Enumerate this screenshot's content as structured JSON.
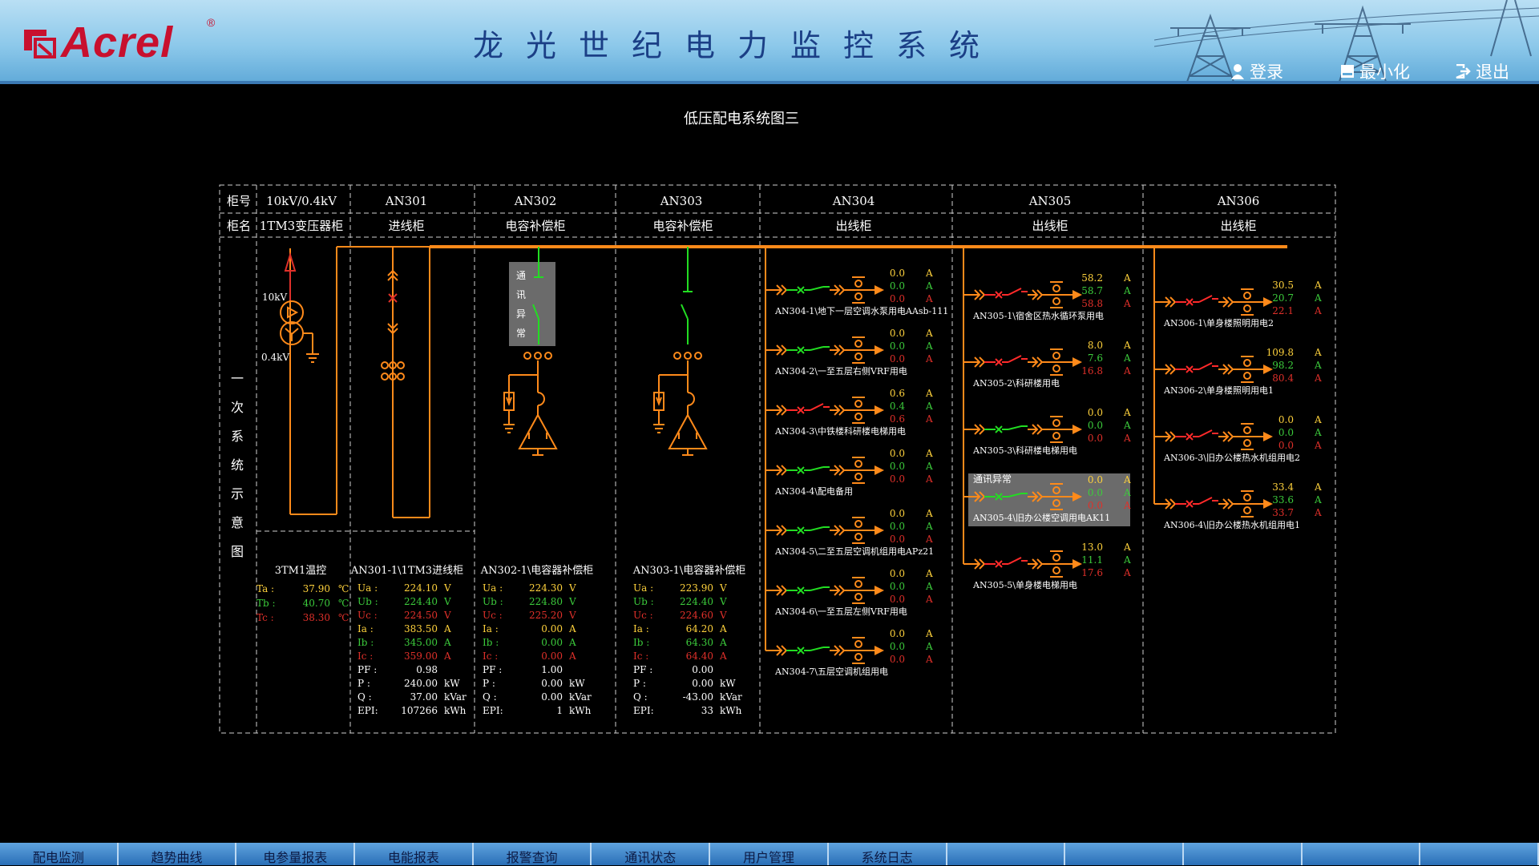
{
  "header": {
    "logo_text": "Acrel",
    "logo_reg": "®",
    "title": "龙光世纪电力监控系统",
    "buttons": [
      {
        "name": "login",
        "label": "登录",
        "icon": "user-icon"
      },
      {
        "name": "minimize",
        "label": "最小化",
        "icon": "minimize-icon"
      },
      {
        "name": "logout",
        "label": "退出",
        "icon": "logout-icon"
      }
    ]
  },
  "page_title": "低压配电系统图三",
  "grid": {
    "row_label_number": "柜号",
    "row_label_name": "柜名",
    "side_label": "一次系统示意图",
    "cabinets": [
      {
        "number": "10kV/0.4kV",
        "name": "1TM3变压器柜"
      },
      {
        "number": "AN301",
        "name": "进线柜"
      },
      {
        "number": "AN302",
        "name": "电容补偿柜"
      },
      {
        "number": "AN303",
        "name": "电容补偿柜"
      },
      {
        "number": "AN304",
        "name": "出线柜"
      },
      {
        "number": "AN305",
        "name": "出线柜"
      },
      {
        "number": "AN306",
        "name": "出线柜"
      }
    ]
  },
  "transformer": {
    "hv_label": "10kV",
    "lv_label": "0.4kV"
  },
  "comm_error_label": "通讯异常",
  "comm_error_vertical": [
    "通",
    "讯",
    "异",
    "常"
  ],
  "temp_panel": {
    "title": "3TM1温控",
    "rows": [
      {
        "label": "Ta :",
        "value": "37.90",
        "unit": "℃",
        "color": "#ffd23c"
      },
      {
        "label": "Tb :",
        "value": "40.70",
        "unit": "℃",
        "color": "#3ccc3c"
      },
      {
        "label": "Tc :",
        "value": "38.30",
        "unit": "℃",
        "color": "#e0302a"
      }
    ]
  },
  "meter_panels": [
    {
      "title": "AN301-1\\1TM3进线柜",
      "rows": [
        {
          "label": "Ua :",
          "value": "224.10",
          "unit": "V",
          "color": "#ffd23c"
        },
        {
          "label": "Ub :",
          "value": "224.40",
          "unit": "V",
          "color": "#3ccc3c"
        },
        {
          "label": "Uc :",
          "value": "224.50",
          "unit": "V",
          "color": "#e0302a"
        },
        {
          "label": "Ia :",
          "value": "383.50",
          "unit": "A",
          "color": "#ffd23c"
        },
        {
          "label": "Ib :",
          "value": "345.00",
          "unit": "A",
          "color": "#3ccc3c"
        },
        {
          "label": "Ic :",
          "value": "359.00",
          "unit": "A",
          "color": "#e0302a"
        },
        {
          "label": "PF :",
          "value": "0.98",
          "unit": "",
          "color": "#ffffff"
        },
        {
          "label": "P  :",
          "value": "240.00",
          "unit": "kW",
          "color": "#ffffff"
        },
        {
          "label": "Q  :",
          "value": "37.00",
          "unit": "kVar",
          "color": "#ffffff"
        },
        {
          "label": "EPI:",
          "value": "107266",
          "unit": "kWh",
          "color": "#ffffff"
        }
      ]
    },
    {
      "title": "AN302-1\\电容器补偿柜",
      "rows": [
        {
          "label": "Ua :",
          "value": "224.30",
          "unit": "V",
          "color": "#ffd23c"
        },
        {
          "label": "Ub :",
          "value": "224.80",
          "unit": "V",
          "color": "#3ccc3c"
        },
        {
          "label": "Uc :",
          "value": "225.20",
          "unit": "V",
          "color": "#e0302a"
        },
        {
          "label": "Ia :",
          "value": "0.00",
          "unit": "A",
          "color": "#ffd23c"
        },
        {
          "label": "Ib :",
          "value": "0.00",
          "unit": "A",
          "color": "#3ccc3c"
        },
        {
          "label": "Ic :",
          "value": "0.00",
          "unit": "A",
          "color": "#e0302a"
        },
        {
          "label": "PF :",
          "value": "1.00",
          "unit": "",
          "color": "#ffffff"
        },
        {
          "label": "P  :",
          "value": "0.00",
          "unit": "kW",
          "color": "#ffffff"
        },
        {
          "label": "Q  :",
          "value": "0.00",
          "unit": "kVar",
          "color": "#ffffff"
        },
        {
          "label": "EPI:",
          "value": "1",
          "unit": "kWh",
          "color": "#ffffff"
        }
      ]
    },
    {
      "title": "AN303-1\\电容器补偿柜",
      "rows": [
        {
          "label": "Ua :",
          "value": "223.90",
          "unit": "V",
          "color": "#ffd23c"
        },
        {
          "label": "Ub :",
          "value": "224.40",
          "unit": "V",
          "color": "#3ccc3c"
        },
        {
          "label": "Uc :",
          "value": "224.60",
          "unit": "V",
          "color": "#e0302a"
        },
        {
          "label": "Ia :",
          "value": "64.20",
          "unit": "A",
          "color": "#ffd23c"
        },
        {
          "label": "Ib :",
          "value": "64.30",
          "unit": "A",
          "color": "#3ccc3c"
        },
        {
          "label": "Ic :",
          "value": "64.40",
          "unit": "A",
          "color": "#e0302a"
        },
        {
          "label": "PF :",
          "value": "0.00",
          "unit": "",
          "color": "#ffffff"
        },
        {
          "label": "P  :",
          "value": "0.00",
          "unit": "kW",
          "color": "#ffffff"
        },
        {
          "label": "Q  :",
          "value": "-43.00",
          "unit": "kVar",
          "color": "#ffffff"
        },
        {
          "label": "EPI:",
          "value": "33",
          "unit": "kWh",
          "color": "#ffffff"
        }
      ]
    }
  ],
  "feeder_columns": [
    {
      "cabinet": "AN304",
      "feeders": [
        {
          "label": "AN304-1\\地下一层空调水泵用电AAsb-111",
          "status": "closed",
          "values": [
            "0.0",
            "0.0",
            "0.0"
          ],
          "unit": "A"
        },
        {
          "label": "AN304-2\\一至五层右侧VRF用电",
          "status": "closed",
          "values": [
            "0.0",
            "0.0",
            "0.0"
          ],
          "unit": "A"
        },
        {
          "label": "AN304-3\\中铁楼科研楼电梯用电",
          "status": "open",
          "values": [
            "0.6",
            "0.4",
            "0.6"
          ],
          "unit": "A"
        },
        {
          "label": "AN304-4\\配电备用",
          "status": "closed",
          "values": [
            "0.0",
            "0.0",
            "0.0"
          ],
          "unit": "A"
        },
        {
          "label": "AN304-5\\二至五层空调机组用电APz21",
          "status": "closed",
          "values": [
            "0.0",
            "0.0",
            "0.0"
          ],
          "unit": "A"
        },
        {
          "label": "AN304-6\\一至五层左侧VRF用电",
          "status": "closed",
          "values": [
            "0.0",
            "0.0",
            "0.0"
          ],
          "unit": "A"
        },
        {
          "label": "AN304-7\\五层空调机组用电",
          "status": "closed",
          "values": [
            "0.0",
            "0.0",
            "0.0"
          ],
          "unit": "A"
        }
      ]
    },
    {
      "cabinet": "AN305",
      "feeders": [
        {
          "label": "AN305-1\\宿舍区热水循环泵用电",
          "status": "open",
          "values": [
            "58.2",
            "58.7",
            "58.8"
          ],
          "unit": "A"
        },
        {
          "label": "AN305-2\\科研楼用电",
          "status": "open",
          "values": [
            "8.0",
            "7.6",
            "16.8"
          ],
          "unit": "A"
        },
        {
          "label": "AN305-3\\科研楼电梯用电",
          "status": "closed",
          "values": [
            "0.0",
            "0.0",
            "0.0"
          ],
          "unit": "A"
        },
        {
          "label": "AN305-4\\旧办公楼空调用电AK11",
          "status": "closed",
          "values": [
            "0.0",
            "0.0",
            "0.0"
          ],
          "unit": "A",
          "comm_error": true
        },
        {
          "label": "AN305-5\\单身楼电梯用电",
          "status": "open",
          "values": [
            "13.0",
            "11.1",
            "17.6"
          ],
          "unit": "A"
        }
      ]
    },
    {
      "cabinet": "AN306",
      "feeders": [
        {
          "label": "AN306-1\\单身楼照明用电2",
          "status": "open",
          "values": [
            "30.5",
            "20.7",
            "22.1"
          ],
          "unit": "A"
        },
        {
          "label": "AN306-2\\单身楼照明用电1",
          "status": "open",
          "values": [
            "109.8",
            "98.2",
            "80.4"
          ],
          "unit": "A"
        },
        {
          "label": "AN306-3\\旧办公楼热水机组用电2",
          "status": "open",
          "values": [
            "0.0",
            "0.0",
            "0.0"
          ],
          "unit": "A"
        },
        {
          "label": "AN306-4\\旧办公楼热水机组用电1",
          "status": "open",
          "values": [
            "33.4",
            "33.6",
            "33.7"
          ],
          "unit": "A"
        }
      ]
    }
  ],
  "colors": {
    "bus": "#ff8a1a",
    "phase_a": "#ffd23c",
    "phase_b": "#3ccc3c",
    "phase_c": "#e0302a",
    "breaker_closed": "#22dd22",
    "breaker_open": "#ff2a2a"
  },
  "nav": {
    "items": [
      "配电监测",
      "趋势曲线",
      "电参量报表",
      "电能报表",
      "报警查询",
      "通讯状态",
      "用户管理",
      "系统日志",
      "",
      "",
      "",
      "",
      ""
    ]
  }
}
